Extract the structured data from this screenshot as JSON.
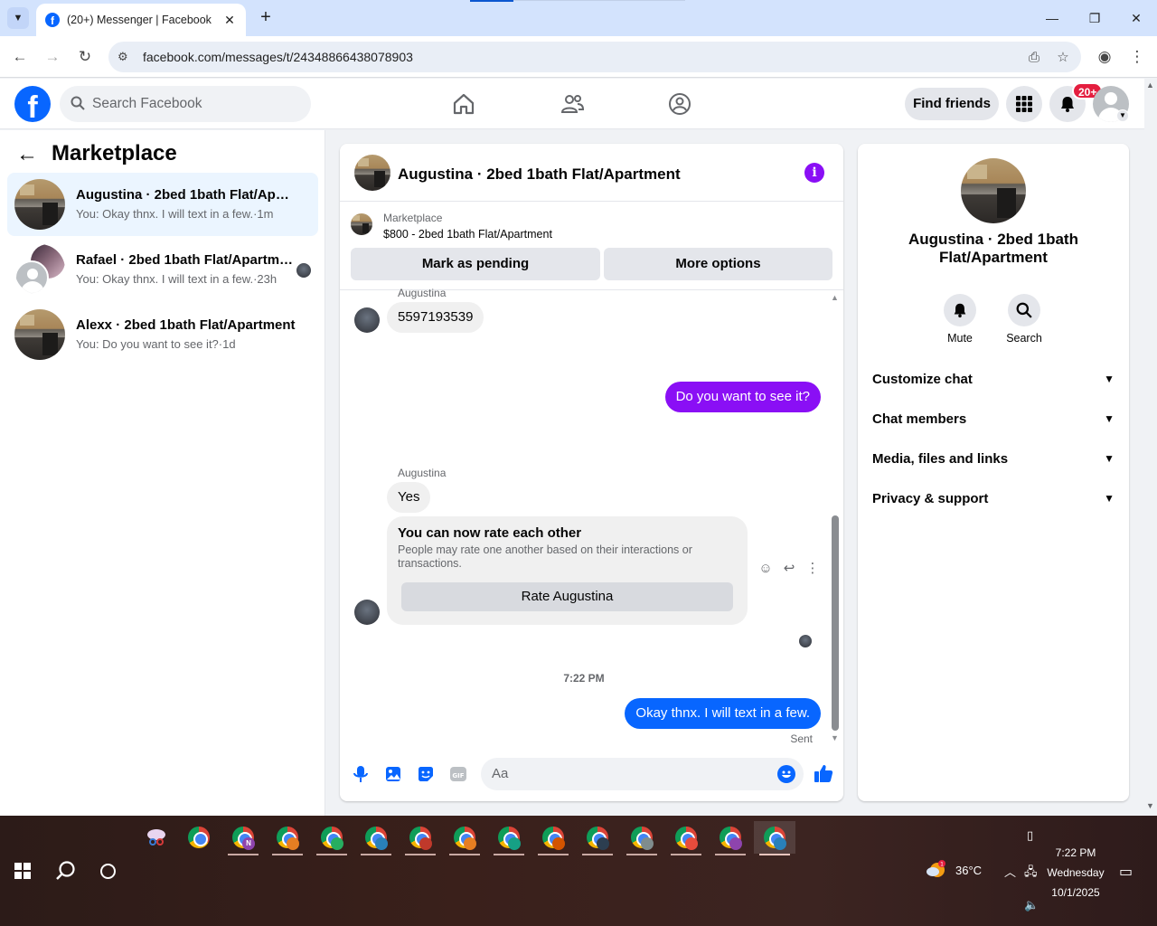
{
  "browser": {
    "tab_title": "(20+) Messenger | Facebook",
    "tab_close": "✕",
    "new_tab": "+",
    "url": "facebook.com/messages/t/24348866438078903",
    "window_controls": [
      "—",
      "❐",
      "✕"
    ]
  },
  "fb_header": {
    "logo": "f",
    "search_placeholder": "Search Facebook",
    "find_friends": "Find friends",
    "notifications_badge": "20+"
  },
  "sidebar": {
    "title": "Marketplace",
    "conversations": [
      {
        "name": "Augustina · 2bed 1bath Flat/Apartment",
        "preview": "You: Okay thnx. I will text in a few.",
        "time": "1m",
        "active": true
      },
      {
        "name": "Rafael · 2bed 1bath Flat/Apartment",
        "preview": "You: Okay thnx. I will text in a few.",
        "time": "23h",
        "active": false
      },
      {
        "name": "Alexx · 2bed 1bath Flat/Apartment",
        "preview": "You: Do you want to see it?",
        "time": "1d",
        "active": false
      }
    ]
  },
  "chat": {
    "title": "Augustina · 2bed 1bath Flat/Apartment",
    "listing_label": "Marketplace",
    "listing": "$800 - 2bed 1bath Flat/Apartment",
    "mark_pending": "Mark as pending",
    "more_options": "More options",
    "messages": {
      "sender_1": "Augustina",
      "msg_phone": "5597193539",
      "msg_out_1": "Do you want to see it?",
      "sender_2": "Augustina",
      "msg_yes": "Yes",
      "rate_title": "You can now rate each other",
      "rate_desc": "People may rate one another based on their interactions or transactions.",
      "rate_button": "Rate Augustina",
      "timestamp": "7:22 PM",
      "msg_out_2": "Okay thnx. I will text in a few.",
      "status": "Sent"
    },
    "composer_placeholder": "Aa"
  },
  "info_panel": {
    "name": "Augustina · 2bed 1bath Flat/Apartment",
    "mute": "Mute",
    "search": "Search",
    "sections": [
      "Customize chat",
      "Chat members",
      "Media, files and links",
      "Privacy & support"
    ]
  },
  "taskbar": {
    "temperature": "36°C",
    "time": "7:22 PM",
    "day": "Wednesday",
    "date": "10/1/2025",
    "profile_badges": [
      "N",
      "",
      "",
      "",
      "",
      "",
      "",
      "",
      "",
      "",
      "",
      "",
      ""
    ]
  },
  "colors": {
    "fb_blue": "#0866ff",
    "messenger_purple": "#8a0ff5",
    "active_conv_bg": "#ebf5ff",
    "notification_red": "#e41e3f"
  }
}
